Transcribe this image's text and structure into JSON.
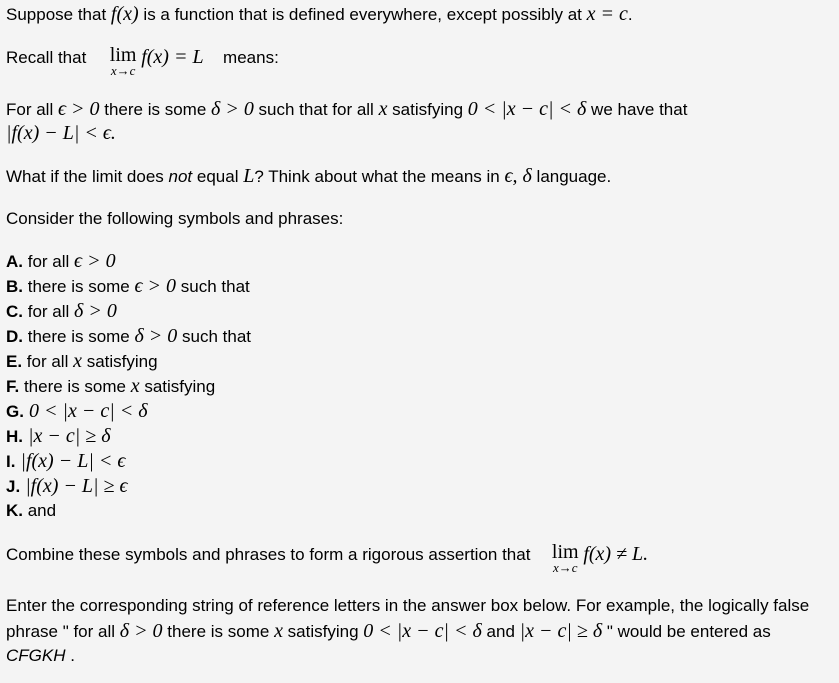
{
  "intro": {
    "p1_a": "Suppose that ",
    "p1_fx": "f(x)",
    "p1_b": " is a function that is defined everywhere, except possibly at ",
    "p1_eq": "x = c",
    "p1_c": ".",
    "recall_a": "Recall that",
    "recall_lim": "lim",
    "recall_sub": "x→c",
    "recall_expr": "f(x) = L",
    "recall_b": "means:"
  },
  "definition": {
    "line1": [
      {
        "t": "text",
        "v": "For all "
      },
      {
        "t": "math",
        "v": "ϵ > 0"
      },
      {
        "t": "text",
        "v": " there is some "
      },
      {
        "t": "math",
        "v": "δ > 0"
      },
      {
        "t": "text",
        "v": " such that for all "
      },
      {
        "t": "math",
        "v": "x"
      },
      {
        "t": "text",
        "v": " satisfying "
      },
      {
        "t": "math",
        "v": "0 < |x − c| < δ"
      },
      {
        "t": "text",
        "v": " we have that"
      }
    ],
    "line2": "|f(x) − L| < ϵ."
  },
  "question": {
    "a": "What if the limit does ",
    "not": "not",
    "b": " equal ",
    "L": "L",
    "c": "? Think about what the means in ",
    "ed": "ϵ, δ",
    "d": " language."
  },
  "consider": "Consider the following symbols and phrases:",
  "options": [
    {
      "letter": "A.",
      "parts": [
        {
          "t": "text",
          "v": " for all "
        },
        {
          "t": "math",
          "v": "ϵ > 0"
        }
      ]
    },
    {
      "letter": "B.",
      "parts": [
        {
          "t": "text",
          "v": " there is some "
        },
        {
          "t": "math",
          "v": "ϵ > 0"
        },
        {
          "t": "text",
          "v": " such that"
        }
      ]
    },
    {
      "letter": "C.",
      "parts": [
        {
          "t": "text",
          "v": " for all "
        },
        {
          "t": "math",
          "v": "δ > 0"
        }
      ]
    },
    {
      "letter": "D.",
      "parts": [
        {
          "t": "text",
          "v": " there is some "
        },
        {
          "t": "math",
          "v": "δ > 0"
        },
        {
          "t": "text",
          "v": " such that"
        }
      ]
    },
    {
      "letter": "E.",
      "parts": [
        {
          "t": "text",
          "v": " for all "
        },
        {
          "t": "math",
          "v": "x"
        },
        {
          "t": "text",
          "v": " satisfying"
        }
      ]
    },
    {
      "letter": "F.",
      "parts": [
        {
          "t": "text",
          "v": " there is some "
        },
        {
          "t": "math",
          "v": "x"
        },
        {
          "t": "text",
          "v": " satisfying"
        }
      ]
    },
    {
      "letter": "G.",
      "parts": [
        {
          "t": "math",
          "v": " 0 < |x − c| < δ"
        }
      ]
    },
    {
      "letter": "H.",
      "parts": [
        {
          "t": "math",
          "v": " |x − c| ≥ δ"
        }
      ]
    },
    {
      "letter": "I.",
      "parts": [
        {
          "t": "math",
          "v": " |f(x) − L| < ϵ"
        }
      ]
    },
    {
      "letter": "J.",
      "parts": [
        {
          "t": "math",
          "v": " |f(x) − L| ≥ ϵ"
        }
      ]
    },
    {
      "letter": "K.",
      "parts": [
        {
          "t": "text",
          "v": " and"
        }
      ]
    }
  ],
  "combine": {
    "a": "Combine these symbols and phrases to form a rigorous assertion that",
    "lim": "lim",
    "sub": "x→c",
    "expr": "f(x) ≠ L."
  },
  "instructions": {
    "line1": "Enter the corresponding string of reference letters in the answer box below. For example, the logically false",
    "line2": [
      {
        "t": "text",
        "v": "phrase \" for all "
      },
      {
        "t": "math",
        "v": "δ > 0"
      },
      {
        "t": "text",
        "v": " there is some "
      },
      {
        "t": "math",
        "v": "x"
      },
      {
        "t": "text",
        "v": " satisfying "
      },
      {
        "t": "math",
        "v": "0 < |x − c| < δ"
      },
      {
        "t": "text",
        "v": " and "
      },
      {
        "t": "math",
        "v": "|x − c| ≥ δ"
      },
      {
        "t": "text",
        "v": " \" would be entered as"
      }
    ],
    "example": "CFGKH",
    "end": " ."
  }
}
